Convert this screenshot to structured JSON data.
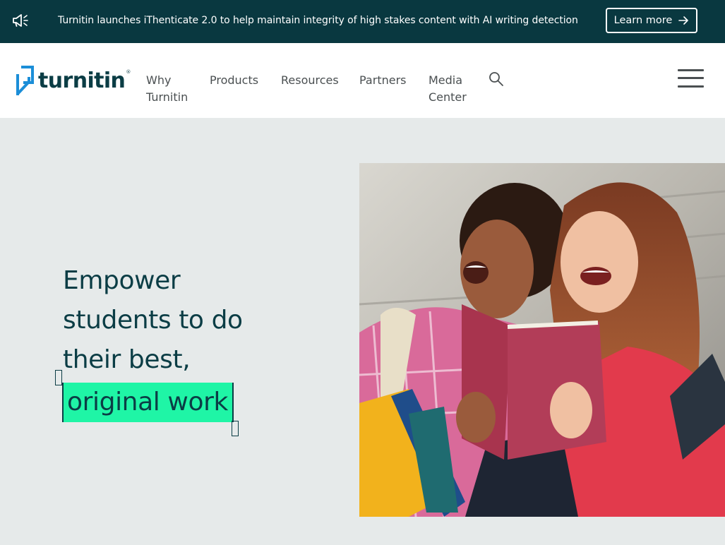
{
  "announcement": {
    "icon": "megaphone-icon",
    "message": "Turnitin launches iThenticate 2.0 to help maintain integrity of high stakes content with AI writing detection",
    "cta_label": "Learn more",
    "cta_icon": "arrow-right-icon"
  },
  "header": {
    "logo_text": "turnitin",
    "logo_tm": "®",
    "nav": [
      {
        "line1": "Why",
        "line2": "Turnitin"
      },
      {
        "line1": "Products"
      },
      {
        "line1": "Resources"
      },
      {
        "line1": "Partners"
      },
      {
        "line1": "Media",
        "line2": "Center"
      }
    ],
    "search_icon": "search-icon",
    "menu_icon": "hamburger-menu-icon"
  },
  "hero": {
    "headline_line1": "Empower",
    "headline_line2": "students to do",
    "headline_line3": "their best,",
    "headline_highlight": "original work",
    "image_alt": "Two students laughing while reading a book"
  },
  "colors": {
    "announcement_bg": "#093840",
    "brand_dark": "#0b3d45",
    "brand_blue": "#1b8ed8",
    "highlight": "#1ff5a6",
    "hero_bg": "#e6eaea"
  }
}
